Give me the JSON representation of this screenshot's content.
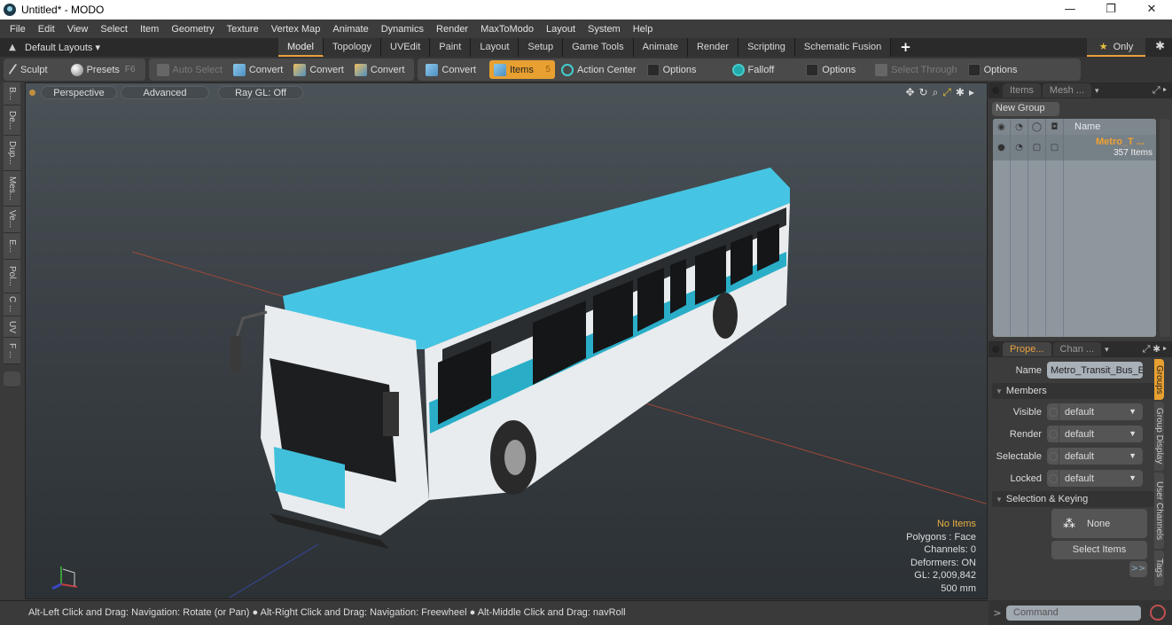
{
  "window": {
    "title": "Untitled* - MODO",
    "controls": {
      "minimize": "—",
      "maximize": "❐",
      "close": "✕"
    }
  },
  "menubar": [
    "File",
    "Edit",
    "View",
    "Select",
    "Item",
    "Geometry",
    "Texture",
    "Vertex Map",
    "Animate",
    "Dynamics",
    "Render",
    "MaxToModo",
    "Layout",
    "System",
    "Help"
  ],
  "layout_bar": {
    "layouts_label": "Default Layouts ▾",
    "tabs": [
      "Model",
      "Topology",
      "UVEdit",
      "Paint",
      "Layout",
      "Setup",
      "Game Tools",
      "Animate",
      "Render",
      "Scripting",
      "Schematic Fusion"
    ],
    "active_tab": "Model",
    "add_label": "+",
    "only_label": "Only"
  },
  "toolbar": {
    "sculpt": "Sculpt",
    "presets": "Presets",
    "presets_key": "F6",
    "auto_select": "Auto Select",
    "convert_1": "Convert",
    "convert_2": "Convert",
    "convert_3": "Convert",
    "convert_4": "Convert",
    "items": "Items",
    "items_key": "5",
    "action_center": "Action Center",
    "options_1": "Options",
    "falloff": "Falloff",
    "options_2": "Options",
    "select_through": "Select Through",
    "options_3": "Options"
  },
  "left_tools": [
    "B...",
    "De...",
    "Dup...",
    "Mes...",
    "Ve...",
    "E...",
    "Pol...",
    "C ...",
    "UV",
    "F ..."
  ],
  "viewport": {
    "view": "Perspective",
    "shading": "Advanced",
    "raygl": "Ray GL: Off",
    "hud": {
      "selection": "No Items",
      "polygons": "Polygons : Face",
      "channels": "Channels: 0",
      "deformers": "Deformers: ON",
      "gl": "GL: 2,009,842",
      "scale": "500 mm"
    }
  },
  "groups_panel": {
    "tabs": [
      "Items",
      "Mesh ..."
    ],
    "new_group": "New Group",
    "name_header": "Name",
    "group": {
      "name": "Metro_T ...",
      "count": "357 Items"
    }
  },
  "properties": {
    "tabs": [
      "Prope...",
      "Chan ..."
    ],
    "name_label": "Name",
    "name_value": "Metro_Transit_Bus_E",
    "members_label": "Members",
    "fields": [
      {
        "label": "Visible",
        "value": "default"
      },
      {
        "label": "Render",
        "value": "default"
      },
      {
        "label": "Selectable",
        "value": "default"
      },
      {
        "label": "Locked",
        "value": "default"
      }
    ],
    "selection_label": "Selection & Keying",
    "none_label": "None",
    "select_items": "Select Items",
    "more": ">>",
    "side_tabs": [
      "Groups",
      "Group Display",
      "User Channels",
      "Tags"
    ]
  },
  "statusbar": {
    "hint_1": "Alt-Left Click and Drag: Navigation: Rotate (or Pan)",
    "hint_2": "Alt-Right Click and Drag: Navigation: Freewheel",
    "hint_3": "Alt-Middle Click and Drag: navRoll"
  },
  "command": {
    "prompt": ">",
    "placeholder": "Command"
  },
  "colors": {
    "accent": "#e8a030",
    "bus_blue": "#3fc4e0",
    "selection_text": "#e8b040"
  }
}
